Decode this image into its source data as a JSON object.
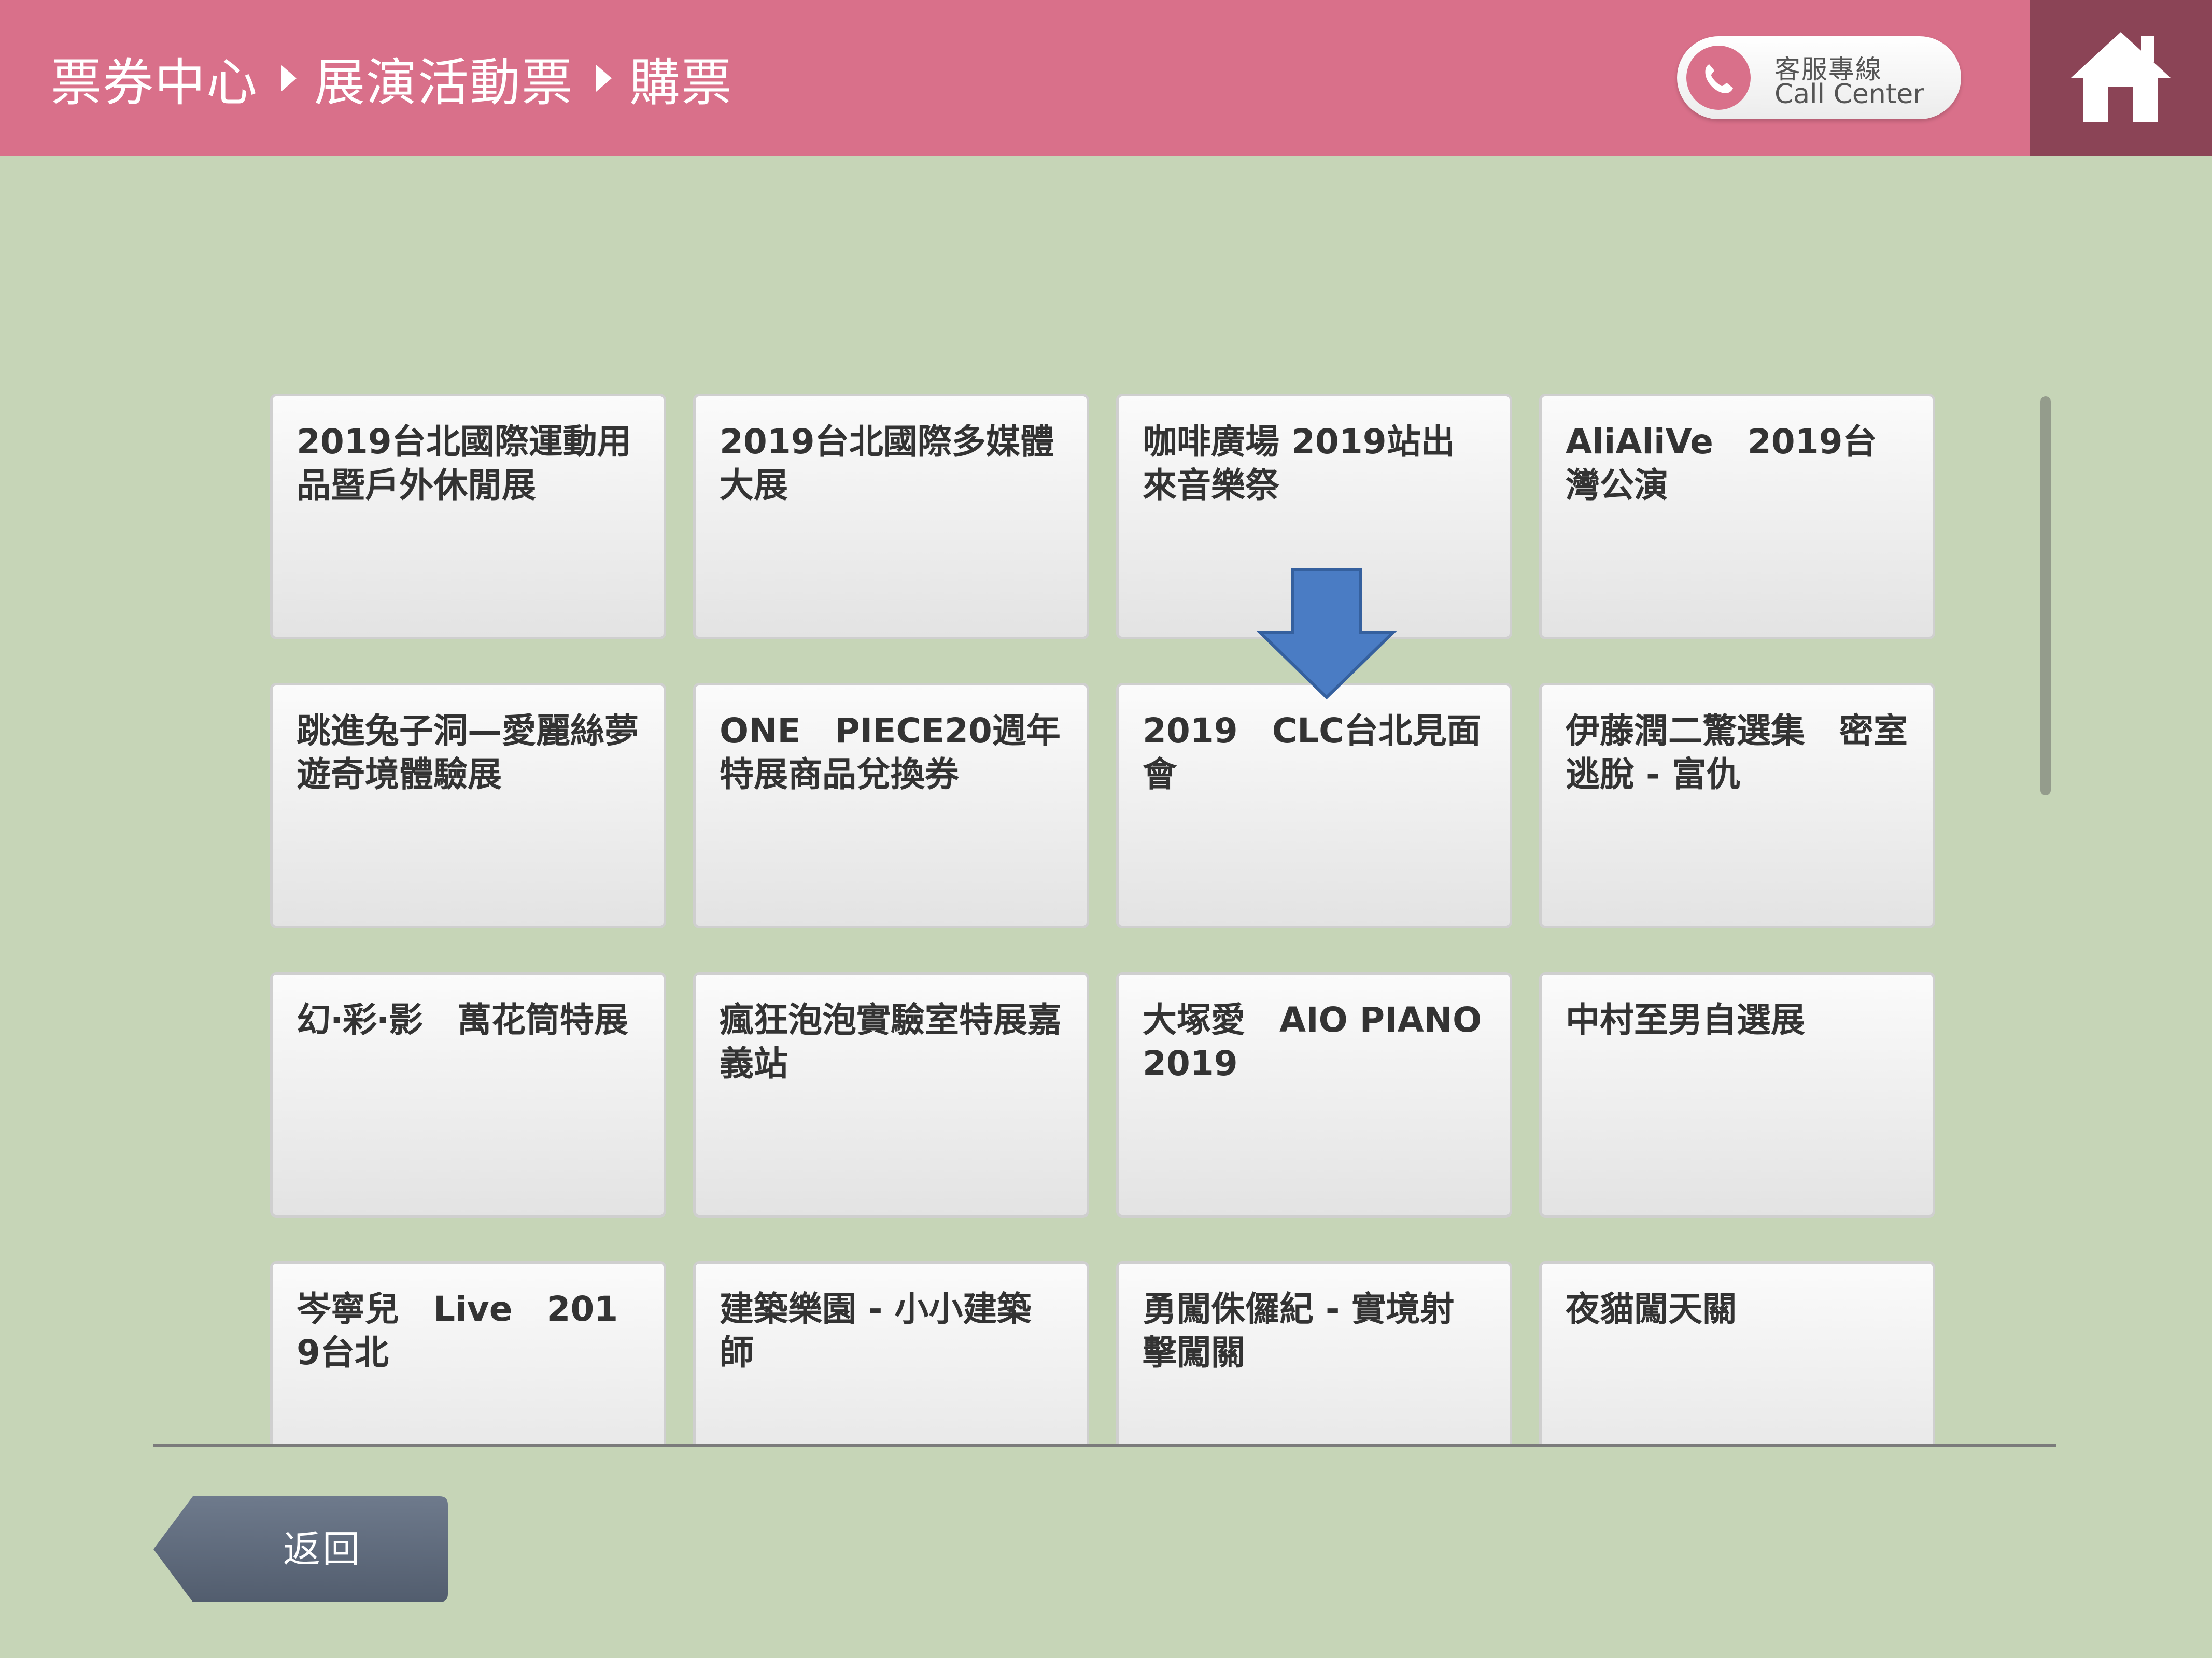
{
  "header": {
    "breadcrumb": [
      "票券中心",
      "展演活動票",
      "購票"
    ],
    "call_center_zh": "客服專線",
    "call_center_en": "Call Center"
  },
  "icons": {
    "breadcrumb_separator": "triangle-right-icon",
    "phone": "phone-icon",
    "home": "home-icon",
    "pointer": "down-arrow-icon"
  },
  "events": [
    "2019台北國際運動用品暨戶外休閒展",
    "2019台北國際多媒體大展",
    "咖啡廣場 2019站出來音樂祭",
    "AliAliVe　2019台灣公演",
    "跳進兔子洞—愛麗絲夢遊奇境體驗展",
    "ONE　PIECE20週年特展商品兌換券",
    "2019　CLC台北見面會",
    "伊藤潤二驚選集　密室逃脫 - 富仇",
    "幻‧彩‧影　萬花筒特展",
    "瘋狂泡泡實驗室特展嘉義站",
    "大塚愛　AIO PIANO　2019",
    "中村至男自選展",
    "岑寧兒　Live　2019台北",
    "建築樂園 - 小小建築師",
    "勇闖侏儸紀 - 實境射擊闖關",
    "夜貓闖天關"
  ],
  "back_button": "返回",
  "colors": {
    "header_bg": "#d9708a",
    "home_bg": "#8b4456",
    "page_bg": "#c6d5b7",
    "button_bg": "#5e6a7c",
    "arrow": "#4a7cc4"
  }
}
